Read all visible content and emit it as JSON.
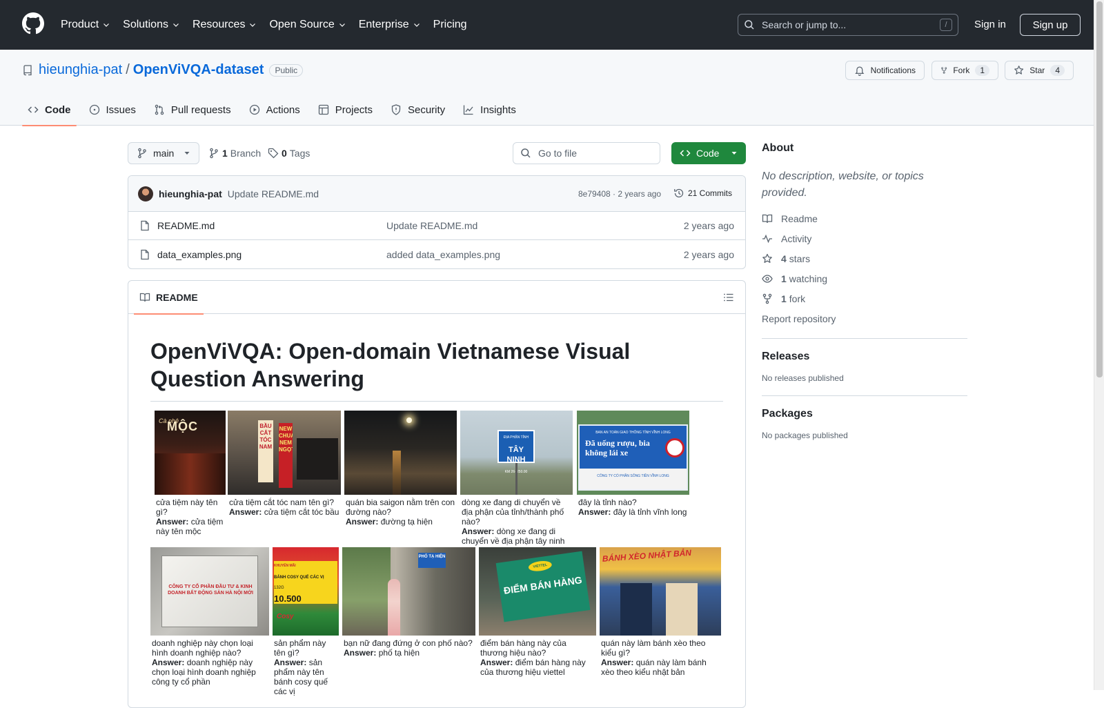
{
  "header": {
    "nav": [
      "Product",
      "Solutions",
      "Resources",
      "Open Source",
      "Enterprise",
      "Pricing"
    ],
    "search_placeholder": "Search or jump to...",
    "search_key": "/",
    "sign_in": "Sign in",
    "sign_up": "Sign up"
  },
  "repo": {
    "owner": "hieunghia-pat",
    "separator": "/",
    "name": "OpenViVQA-dataset",
    "visibility": "Public",
    "notifications": "Notifications",
    "fork_label": "Fork",
    "fork_count": "1",
    "star_label": "Star",
    "star_count": "4",
    "tabs": [
      "Code",
      "Issues",
      "Pull requests",
      "Actions",
      "Projects",
      "Security",
      "Insights"
    ]
  },
  "files": {
    "branch": "main",
    "branch_count": "1",
    "branch_label": "Branch",
    "tag_count": "0",
    "tag_label": "Tags",
    "goto_placeholder": "Go to file",
    "code_button": "Code",
    "commit": {
      "author": "hieunghia-pat",
      "message": "Update README.md",
      "meta": "8e79408 · 2 years ago",
      "commits": "21 Commits"
    },
    "rows": [
      {
        "name": "README.md",
        "message": "Update README.md",
        "age": "2 years ago"
      },
      {
        "name": "data_examples.png",
        "message": "added data_examples.png",
        "age": "2 years ago"
      }
    ]
  },
  "readme": {
    "tab": "README",
    "title": "OpenViVQA: Open-domain Vietnamese Visual Question Answering",
    "answer_label": "Answer:",
    "examples_row1": [
      {
        "q": "cửa tiệm này tên gì?",
        "a": "cửa tiệm này tên mộc"
      },
      {
        "q": "cửa tiệm cắt tóc nam tên gì?",
        "a": "cửa tiệm cắt tóc bầu"
      },
      {
        "q": "quán bia saigon nằm trên con đường nào?",
        "a": "đường tạ hiện"
      },
      {
        "q": "dòng xe đang di chuyển về địa phận của tỉnh/thành phố nào?",
        "a": "dòng xe đang di chuyển về địa phận tây ninh"
      },
      {
        "q": "đây là tỉnh nào?",
        "a": "đây là tỉnh vĩnh long"
      }
    ],
    "examples_row2": [
      {
        "q": "doanh nghiệp này chọn loại hình doanh nghiệp nào?",
        "a": "doanh nghiệp này chọn loại hình doanh nghiệp công ty cổ phần"
      },
      {
        "q": "sản phẩm này tên gì?",
        "a": "sản phẩm này tên bánh cosy quế các vị"
      },
      {
        "q": "bạn nữ đang đứng ở con phố nào?",
        "a": "phố tạ hiện"
      },
      {
        "q": "điểm bán hàng này của thương hiệu nào?",
        "a": "điểm bán hàng này của thương hiệu viettel"
      },
      {
        "q": "quán này làm bánh xèo theo kiểu gì?",
        "a": "quán này làm bánh xèo theo kiểu nhật bản"
      }
    ],
    "image_text": {
      "moc": "MỘC",
      "moc_small": "Cà phê",
      "hair_sign": "BẦU CẮT TÓC NAM",
      "hair_sign2": "NEW CHUA NEM NGỌT",
      "tayninh_top": "ĐỊA PHẬN TỈNH",
      "tayninh": "TÂY NINH",
      "tayninh_km": "KM 26+250.00",
      "vinhlong_top": "BAN AN TOÀN GIAO THÔNG TỈNH VĨNH LONG",
      "vinhlong": "Đã uống rượu, bia không lái xe",
      "vinhlong_bottom": "CÔNG TY CỔ PHẦN SÔNG TIỀN VĨNH LONG",
      "company": "CÔNG TY CỔ PHẦN ĐẦU TƯ & KINH DOANH BẤT ĐỘNG SẢN HÀ NỘI MỚI",
      "cosy_top": "KHUYẾN MÃI",
      "cosy": "BÁNH COSY QUẾ CÁC VỊ",
      "cosy_weight": "132G",
      "cosy_price": "10.500",
      "cosy_brand": "Cosy",
      "tahien": "PHỐ TẠ HIỆN",
      "viettel_brand": "VIETTEL",
      "viettel": "ĐIỂM BÁN HÀNG",
      "banhxeo": "BÁNH XÈO NHẬT BẢN"
    }
  },
  "about": {
    "title": "About",
    "description": "No description, website, or topics provided.",
    "links": [
      {
        "icon": "book-icon",
        "count": "",
        "label": "Readme"
      },
      {
        "icon": "pulse-icon",
        "count": "",
        "label": "Activity"
      },
      {
        "icon": "star-icon",
        "count": "4",
        "label": "stars"
      },
      {
        "icon": "eye-icon",
        "count": "1",
        "label": "watching"
      },
      {
        "icon": "fork-icon",
        "count": "1",
        "label": "fork"
      }
    ],
    "report": "Report repository",
    "releases_title": "Releases",
    "releases_text": "No releases published",
    "packages_title": "Packages",
    "packages_text": "No packages published"
  }
}
